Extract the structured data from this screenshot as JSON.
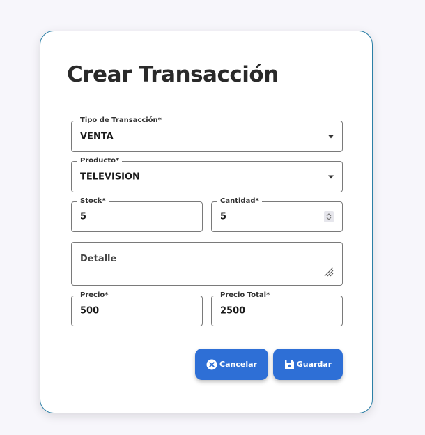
{
  "form": {
    "title": "Crear Transacción",
    "tipo": {
      "label": "Tipo de Transacción*",
      "value": "VENTA"
    },
    "producto": {
      "label": "Producto*",
      "value": "TELEVISION"
    },
    "stock": {
      "label": "Stock*",
      "value": "5"
    },
    "cantidad": {
      "label": "Cantidad*",
      "value": "5"
    },
    "detalle": {
      "placeholder": "Detalle"
    },
    "precio": {
      "label": "Precio*",
      "value": "500"
    },
    "precio_total": {
      "label": "Precio Total*",
      "value": "2500"
    }
  },
  "buttons": {
    "cancel_label": "Cancelar",
    "save_label": "Guardar"
  },
  "icons": {
    "cancel": "close-circle-icon",
    "save": "floppy-disk-icon",
    "select": "chevron-down-icon",
    "spinner": "number-spinner-icon",
    "resize": "resize-handle-icon"
  },
  "colors": {
    "accent": "#2e6fd6",
    "card_border": "#2b7fa6",
    "background": "#f7f6fb"
  }
}
